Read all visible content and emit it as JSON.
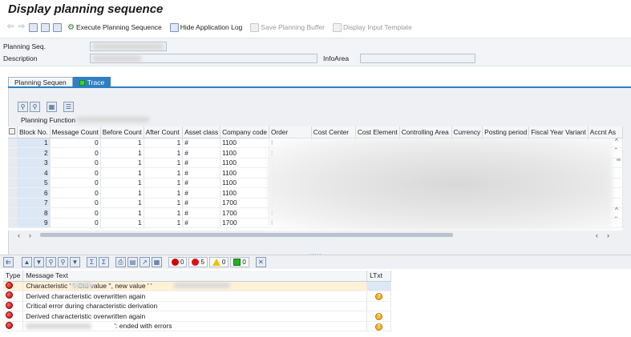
{
  "window": {
    "title": "Display planning sequence"
  },
  "toolbar": {
    "execute_label": "Execute Planning Sequence",
    "hide_log_label": "Hide Application Log",
    "save_buffer_label": "Save Planning Buffer",
    "display_template_label": "Display Input Template"
  },
  "header": {
    "planning_seq_label": "Planning Seq.",
    "description_label": "Description",
    "infoarea_label": "InfoArea"
  },
  "tabs": [
    {
      "label": "Planning Sequen"
    },
    {
      "label": "Trace"
    }
  ],
  "planning_function_label": "Planning Function",
  "grid": {
    "columns": [
      "Block No.",
      "Message Count",
      "Before Count",
      "After Count",
      "Asset class",
      "Company code",
      "Order",
      "Cost Center",
      "Cost Element",
      "Controlling Area",
      "Currency",
      "Posting period",
      "Fiscal Year Variant",
      "Accnt As"
    ],
    "rows": [
      {
        "block": "1",
        "msg": "0",
        "before": "1",
        "after": "1",
        "asset": "#",
        "company": "1100",
        "order": "I"
      },
      {
        "block": "2",
        "msg": "0",
        "before": "1",
        "after": "1",
        "asset": "#",
        "company": "1100",
        "order": "I"
      },
      {
        "block": "3",
        "msg": "0",
        "before": "1",
        "after": "1",
        "asset": "#",
        "company": "1100",
        "order": "I"
      },
      {
        "block": "4",
        "msg": "0",
        "before": "1",
        "after": "1",
        "asset": "#",
        "company": "1100",
        "order": "I"
      },
      {
        "block": "5",
        "msg": "0",
        "before": "1",
        "after": "1",
        "asset": "#",
        "company": "1100",
        "order": "I"
      },
      {
        "block": "6",
        "msg": "0",
        "before": "1",
        "after": "1",
        "asset": "#",
        "company": "1100",
        "order": "I"
      },
      {
        "block": "7",
        "msg": "0",
        "before": "1",
        "after": "1",
        "asset": "#",
        "company": "1700",
        "order": "I"
      },
      {
        "block": "8",
        "msg": "0",
        "before": "1",
        "after": "1",
        "asset": "#",
        "company": "1700",
        "order": "I"
      },
      {
        "block": "9",
        "msg": "0",
        "before": "1",
        "after": "1",
        "asset": "#",
        "company": "1700",
        "order": "I"
      }
    ]
  },
  "log": {
    "counts": {
      "errors": "0",
      "warnings_red": "5",
      "warnings": "0",
      "success": "0"
    },
    "columns": [
      "Type",
      "Message Text",
      "LTxt"
    ],
    "rows": [
      {
        "text": "Characteristic '         ': Old value '', new value '                              '",
        "ltxt": false
      },
      {
        "text": "Derived characteristic overwritten again",
        "ltxt": true
      },
      {
        "text": "Critical error during characteristic derivation",
        "ltxt": false
      },
      {
        "text": "Derived characteristic overwritten again",
        "ltxt": true
      },
      {
        "text": "': ended with errors",
        "ltxt": true
      }
    ]
  },
  "colors": {
    "accent": "#2f7fc3",
    "error": "#c00000",
    "info": "#f3b42c"
  }
}
